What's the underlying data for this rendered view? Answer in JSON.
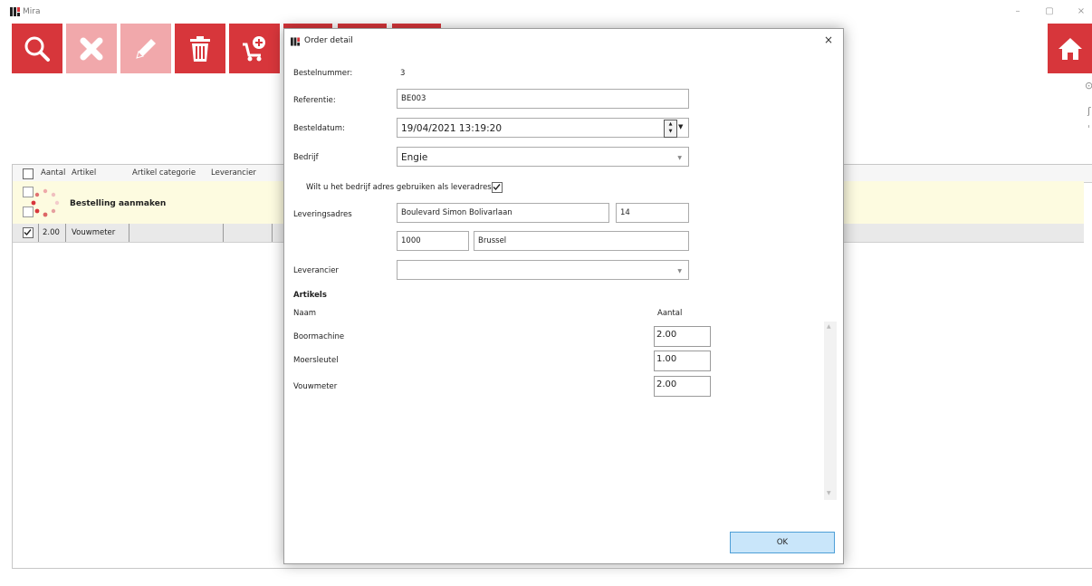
{
  "app": {
    "title": "Mira"
  },
  "window_controls": {
    "minimize": "–",
    "maximize": "▢",
    "close": "×"
  },
  "toolbar": {
    "buttons": [
      {
        "icon": "search-icon"
      },
      {
        "icon": "delete-x-icon"
      },
      {
        "icon": "edit-pencil-icon"
      },
      {
        "icon": "trash-icon"
      },
      {
        "icon": "cart-add-icon"
      }
    ],
    "home_icon": "home-icon"
  },
  "grid": {
    "columns": [
      "Aantal",
      "Artikel",
      "Artikel categorie",
      "Leverancier"
    ],
    "busy_text": "Bestelling aanmaken",
    "rows": [
      {
        "checked": true,
        "aantal": "2.00",
        "artikel": "Vouwmeter"
      }
    ]
  },
  "dialog": {
    "title": "Order detail",
    "close": "×",
    "bestelnummer_label": "Bestelnummer:",
    "bestelnummer_value": "3",
    "referentie_label": "Referentie:",
    "referentie_value": "BE003",
    "besteldatum_label": "Besteldatum:",
    "besteldatum_value": "19/04/2021 13:19:20",
    "bedrijf_label": "Bedrijf",
    "bedrijf_value": "Engie",
    "use_address_label": "Wilt u het bedrijf adres gebruiken als leveradres?",
    "use_address_checked": true,
    "leveringsadres_label": "Leveringsadres",
    "street": "Boulevard Simon Bolivarlaan",
    "number": "14",
    "postcode": "1000",
    "city": "Brussel",
    "leverancier_label": "Leverancier",
    "leverancier_value": "",
    "artikels_title": "Artikels",
    "naam_header": "Naam",
    "aantal_header": "Aantal",
    "articles": [
      {
        "name": "Boormachine",
        "qty": "2.00"
      },
      {
        "name": "Moersleutel",
        "qty": "1.00"
      },
      {
        "name": "Vouwmeter",
        "qty": "2.00"
      }
    ],
    "ok_label": "OK"
  },
  "colors": {
    "accent_red": "#d7363b",
    "ok_blue": "#c9e6fa",
    "busy_yellow": "#fdfbe0"
  }
}
